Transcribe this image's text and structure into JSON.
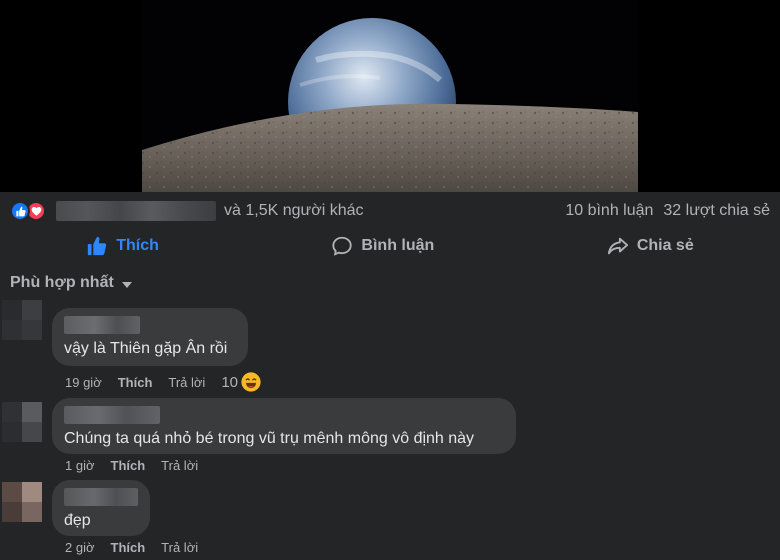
{
  "post": {
    "image_alt": "Earthrise over lunar horizon"
  },
  "stats": {
    "reactions_suffix": "và 1,5K người khác",
    "comments_count": "10 bình luận",
    "shares_count": "32 lượt chia sẻ"
  },
  "actions": {
    "like": "Thích",
    "comment": "Bình luận",
    "share": "Chia sẻ"
  },
  "filter": {
    "label": "Phù hợp nhất"
  },
  "comments": [
    {
      "text": "vậy là Thiên gặp Ân rồi",
      "time": "19 giờ",
      "like": "Thích",
      "reply": "Trả lời",
      "reactions": "10",
      "reaction_icon": "laughing-emoji-icon"
    },
    {
      "text": "Chúng ta quá nhỏ bé trong vũ trụ mênh mông vô định này",
      "time": "1 giờ",
      "like": "Thích",
      "reply": "Trả lời"
    },
    {
      "text": "đẹp",
      "time": "2 giờ",
      "like": "Thích",
      "reply": "Trả lời"
    }
  ],
  "colors": {
    "background": "#242526",
    "bubble": "#3a3b3c",
    "accent": "#2d88ff",
    "secondary_text": "#b0b3b8"
  }
}
